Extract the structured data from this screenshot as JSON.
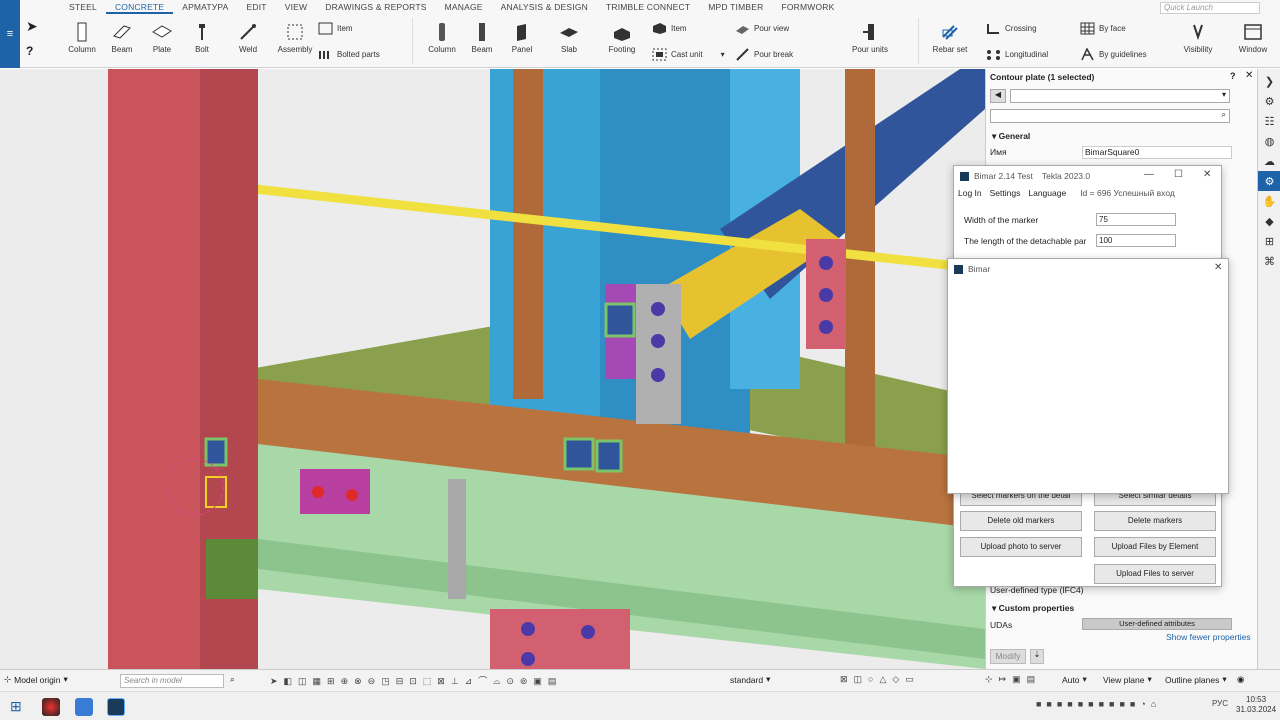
{
  "ribbon": {
    "file_label": "≡",
    "quick_launch": "Quick Launch",
    "tabs": [
      "STEEL",
      "CONCRETE",
      "АРМАТУРА",
      "EDIT",
      "VIEW",
      "DRAWINGS & REPORTS",
      "MANAGE",
      "ANALYSIS & DESIGN",
      "TRIMBLE CONNECT",
      "MPD TIMBER",
      "FORMWORK"
    ],
    "active_tab": "CONCRETE",
    "steel_buttons": [
      "Column",
      "Beam",
      "Plate",
      "Bolt",
      "Weld",
      "Assembly"
    ],
    "steel_small": [
      "Item",
      "Bolted parts"
    ],
    "concrete_buttons": [
      "Column",
      "Beam",
      "Panel",
      "Slab",
      "Footing"
    ],
    "concrete_small": [
      "Item",
      "Cast unit",
      "Pour view",
      "Pour break"
    ],
    "pour_units": "Pour units",
    "rebar_set": "Rebar set",
    "rebar_small": [
      "Crossing",
      "Longitudinal",
      "By face",
      "By guidelines"
    ],
    "visibility": "Visibility",
    "window": "Window"
  },
  "props": {
    "title": "Contour plate (1 selected)",
    "section_general": "General",
    "name_label": "Имя",
    "name_value": "BimarSquare0",
    "udt_label": "User-defined type (IFC4)",
    "section_custom": "Custom properties",
    "udas_label": "UDAs",
    "udas_button": "User-defined attributes",
    "show_fewer": "Show fewer properties",
    "modify": "Modify"
  },
  "bimar_main": {
    "title": "Bimar 2.14 Test",
    "app": "Tekla 2023.0",
    "menu": [
      "Log In",
      "Settings",
      "Language"
    ],
    "status": "Id = 696 Успешный вход",
    "width_label": "Width of the marker",
    "width_value": "75",
    "length_label": "The length of the detachable par",
    "length_value": "100",
    "buttons": [
      "Select markers on the detail",
      "Select similar details",
      "Delete old markers",
      "Delete markers",
      "Upload photo to server",
      "Upload Files by Element",
      "Upload Files to server"
    ]
  },
  "bimar_popup": {
    "title": "Bimar"
  },
  "statusbar": {
    "origin": "Model origin",
    "search_placeholder": "Search in model",
    "standard": "standard",
    "auto": "Auto",
    "view_plane": "View plane",
    "outline_planes": "Outline planes"
  },
  "taskbar": {
    "lang": "РУС",
    "time": "10:53",
    "date": "31.03.2024"
  },
  "colors": {
    "accent": "#1e63a8",
    "red_column": "#c9545c",
    "blue_col": "#3aa3d6",
    "brown": "#b06a3a",
    "green_beam": "#a8d8a8",
    "yellow_pipe": "#f0e040"
  }
}
